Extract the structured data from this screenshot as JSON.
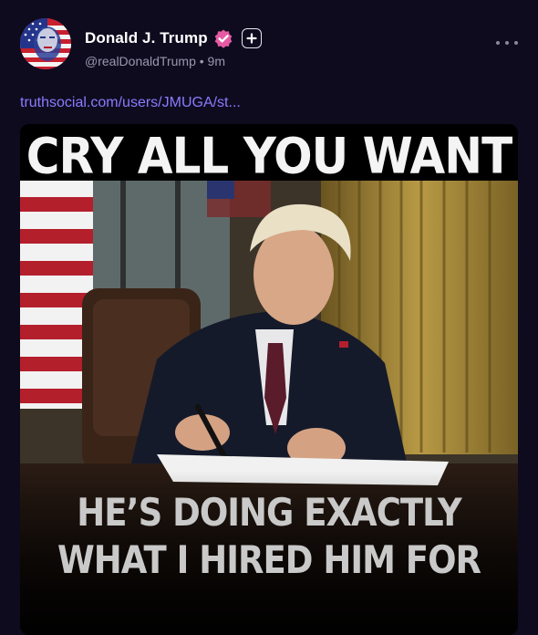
{
  "post": {
    "author": {
      "display_name": "Donald J. Trump",
      "handle": "@realDonaldTrump",
      "separator": "•",
      "time_ago": "9m",
      "avatar_icon": "american-flag-portrait-avatar",
      "verified_icon": "verified-badge-icon",
      "verified_color": "#e65aa3",
      "follow_icon": "plus-icon"
    },
    "more_icon": "more-horizontal-icon",
    "link_text": "truthsocial.com/users/JMUGA/st...",
    "link_color": "#8b7bff",
    "media": {
      "type": "image",
      "top_caption": "CRY ALL YOU WANT",
      "bottom_caption_line1": "HE’S DOING EXACTLY",
      "bottom_caption_line2": "WHAT I HIRED HIM FOR"
    }
  },
  "theme": {
    "background": "#0e0b1f",
    "text_primary": "#ffffff",
    "text_secondary": "#9a97ad"
  }
}
